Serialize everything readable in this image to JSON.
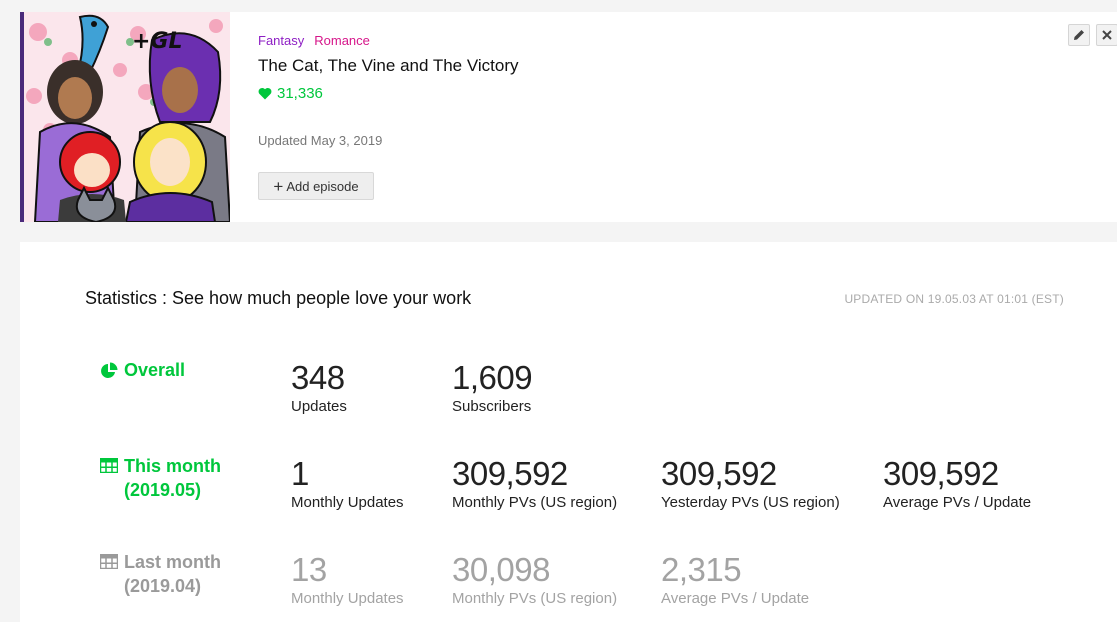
{
  "series": {
    "genres": [
      "Fantasy",
      "Romance"
    ],
    "title": "The Cat, The Vine and The Victory",
    "likes": "31,336",
    "updated": "Updated May 3, 2019",
    "add_episode_label": "Add episode",
    "cover_text": "+GL"
  },
  "stats": {
    "heading": "Statistics : See how much people love your work",
    "updated_on": "UPDATED ON 19.05.03 AT 01:01 (EST)",
    "overall": {
      "label": "Overall",
      "items": [
        {
          "value": "348",
          "caption": "Updates"
        },
        {
          "value": "1,609",
          "caption": "Subscribers"
        }
      ]
    },
    "this_month": {
      "label": "This month",
      "period": "(2019.05)",
      "items": [
        {
          "value": "1",
          "caption": "Monthly Updates"
        },
        {
          "value": "309,592",
          "caption": "Monthly PVs (US region)"
        },
        {
          "value": "309,592",
          "caption": "Yesterday PVs (US region)"
        },
        {
          "value": "309,592",
          "caption": "Average PVs / Update"
        }
      ]
    },
    "last_month": {
      "label": "Last month",
      "period": "(2019.04)",
      "items": [
        {
          "value": "13",
          "caption": "Monthly Updates"
        },
        {
          "value": "30,098",
          "caption": "Monthly PVs (US region)"
        },
        {
          "value": "2,315",
          "caption": "Average PVs / Update"
        }
      ]
    }
  },
  "colors": {
    "accent_green": "#00c73c",
    "fantasy": "#8e1fc4",
    "romance": "#d6168a",
    "muted": "#a3a3a3"
  },
  "icons": [
    "heart-icon",
    "plus-icon",
    "pencil-icon",
    "close-icon",
    "pie-chart-icon",
    "table-icon"
  ]
}
